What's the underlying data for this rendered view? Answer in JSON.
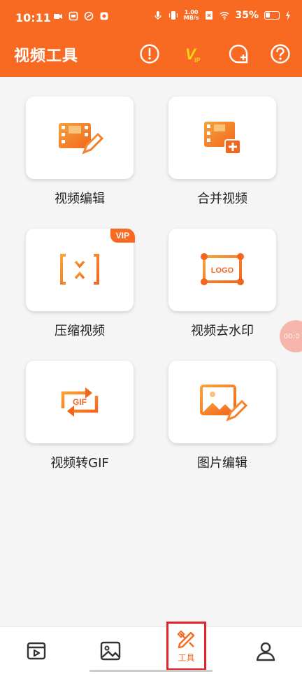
{
  "status_bar": {
    "time": "10:11",
    "net_speed_top": "1.00",
    "net_speed_bottom": "MB/s",
    "battery": "35%"
  },
  "header": {
    "title": "视频工具",
    "icons": [
      "info-icon",
      "vip-icon",
      "feedback-icon",
      "help-icon"
    ],
    "vip_mark": "V"
  },
  "tools": [
    {
      "label": "视频编辑",
      "icon": "video-edit-icon"
    },
    {
      "label": "合并视频",
      "icon": "video-merge-icon"
    },
    {
      "label": "压缩视频",
      "icon": "video-compress-icon",
      "badge": "VIP"
    },
    {
      "label": "视频去水印",
      "icon": "watermark-remove-icon",
      "logo_text": "LOGO"
    },
    {
      "label": "视频转GIF",
      "icon": "gif-convert-icon",
      "gif_text": "GIF"
    },
    {
      "label": "图片编辑",
      "icon": "image-edit-icon"
    }
  ],
  "float_bubble": "00:0",
  "bottom_nav": {
    "items": [
      {
        "name": "video-tab",
        "icon": "video-icon"
      },
      {
        "name": "image-tab",
        "icon": "picture-icon"
      },
      {
        "name": "tools-tab",
        "icon": "tools-icon",
        "label": "工具",
        "active": true
      },
      {
        "name": "profile-tab",
        "icon": "user-icon"
      }
    ]
  },
  "colors": {
    "brand": "#f86a22",
    "icon_gradient_start": "#f7a23a",
    "icon_gradient_end": "#f2661f",
    "active_outline": "#e2232a"
  }
}
